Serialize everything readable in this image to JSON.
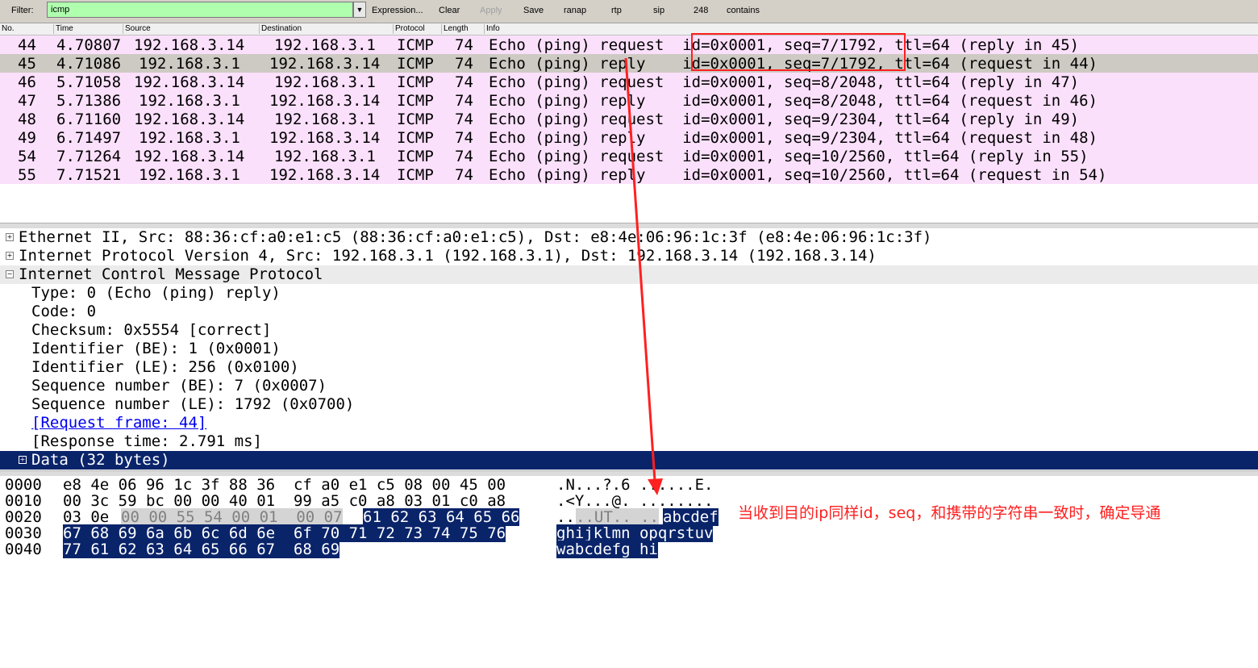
{
  "toolbar": {
    "filter_label": "Filter:",
    "filter_value": "icmp",
    "buttons": [
      "Expression...",
      "Clear",
      "Apply",
      "Save",
      "ranap",
      "rtp",
      "sip",
      "248",
      "contains"
    ]
  },
  "columns": [
    "No.",
    "Time",
    "Source",
    "Destination",
    "Protocol",
    "Length",
    "Info"
  ],
  "packets": [
    {
      "no": "44",
      "time": "4.70807",
      "src": "192.168.3.14",
      "dst": "192.168.3.1",
      "proto": "ICMP",
      "len": "74",
      "info": "Echo (ping) request  id=0x0001, seq=7/1792, ttl=64 (reply in 45)"
    },
    {
      "no": "45",
      "time": "4.71086",
      "src": "192.168.3.1",
      "dst": "192.168.3.14",
      "proto": "ICMP",
      "len": "74",
      "info": "Echo (ping) reply    id=0x0001, seq=7/1792, ttl=64 (request in 44)"
    },
    {
      "no": "46",
      "time": "5.71058",
      "src": "192.168.3.14",
      "dst": "192.168.3.1",
      "proto": "ICMP",
      "len": "74",
      "info": "Echo (ping) request  id=0x0001, seq=8/2048, ttl=64 (reply in 47)"
    },
    {
      "no": "47",
      "time": "5.71386",
      "src": "192.168.3.1",
      "dst": "192.168.3.14",
      "proto": "ICMP",
      "len": "74",
      "info": "Echo (ping) reply    id=0x0001, seq=8/2048, ttl=64 (request in 46)"
    },
    {
      "no": "48",
      "time": "6.71160",
      "src": "192.168.3.14",
      "dst": "192.168.3.1",
      "proto": "ICMP",
      "len": "74",
      "info": "Echo (ping) request  id=0x0001, seq=9/2304, ttl=64 (reply in 49)"
    },
    {
      "no": "49",
      "time": "6.71497",
      "src": "192.168.3.1",
      "dst": "192.168.3.14",
      "proto": "ICMP",
      "len": "74",
      "info": "Echo (ping) reply    id=0x0001, seq=9/2304, ttl=64 (request in 48)"
    },
    {
      "no": "54",
      "time": "7.71264",
      "src": "192.168.3.14",
      "dst": "192.168.3.1",
      "proto": "ICMP",
      "len": "74",
      "info": "Echo (ping) request  id=0x0001, seq=10/2560, ttl=64 (reply in 55)"
    },
    {
      "no": "55",
      "time": "7.71521",
      "src": "192.168.3.1",
      "dst": "192.168.3.14",
      "proto": "ICMP",
      "len": "74",
      "info": "Echo (ping) reply    id=0x0001, seq=10/2560, ttl=64 (request in 54)"
    }
  ],
  "details": {
    "ethernet": "Ethernet II, Src: 88:36:cf:a0:e1:c5 (88:36:cf:a0:e1:c5), Dst: e8:4e:06:96:1c:3f (e8:4e:06:96:1c:3f)",
    "ip": "Internet Protocol Version 4, Src: 192.168.3.1 (192.168.3.1), Dst: 192.168.3.14 (192.168.3.14)",
    "icmp": "Internet Control Message Protocol",
    "icmp_fields": [
      "Type: 0 (Echo (ping) reply)",
      "Code: 0",
      "Checksum: 0x5554 [correct]",
      "Identifier (BE): 1 (0x0001)",
      "Identifier (LE): 256 (0x0100)",
      "Sequence number (BE): 7 (0x0007)",
      "Sequence number (LE): 1792 (0x0700)"
    ],
    "request_frame": "[Request frame: 44]",
    "response_time": "[Response time: 2.791 ms]",
    "data": "Data (32 bytes)"
  },
  "hex": {
    "offsets": [
      "0000",
      "0010",
      "0020",
      "0030",
      "0040"
    ],
    "r0": {
      "bytes": "e8 4e 06 96 1c 3f 88 36  cf a0 e1 c5 08 00 45 00",
      "ascii": ".N...?.6 ......E."
    },
    "r1": {
      "bytes": "00 3c 59 bc 00 00 40 01  99 a5 c0 a8 03 01 c0 a8",
      "ascii": ".<Y...@. ........"
    },
    "r2": {
      "plain": "03 0e ",
      "gray": "00 00 55 54 00 01  00 07",
      "sel": "61 62 63 64 65 66",
      "ascii_plain": "..",
      "ascii_gray": "..UT.. ..",
      "ascii_sel": "abcdef"
    },
    "r3": {
      "sel": "67 68 69 6a 6b 6c 6d 6e  6f 70 71 72 73 74 75 76",
      "ascii_sel": "ghijklmn opqrstuv"
    },
    "r4": {
      "sel": "77 61 62 63 64 65 66 67  68 69",
      "ascii_sel": "wabcdefg hi"
    }
  },
  "annotation": {
    "note": "当收到目的ip同样id，seq，和携带的字符串一致时，确定导通",
    "color": "#ff2020"
  },
  "colors": {
    "filter_bg": "#afffaf",
    "icmp_row": "#fbe0fb",
    "selected_row": "#cdcac3",
    "selection_blue": "#0a246a"
  }
}
